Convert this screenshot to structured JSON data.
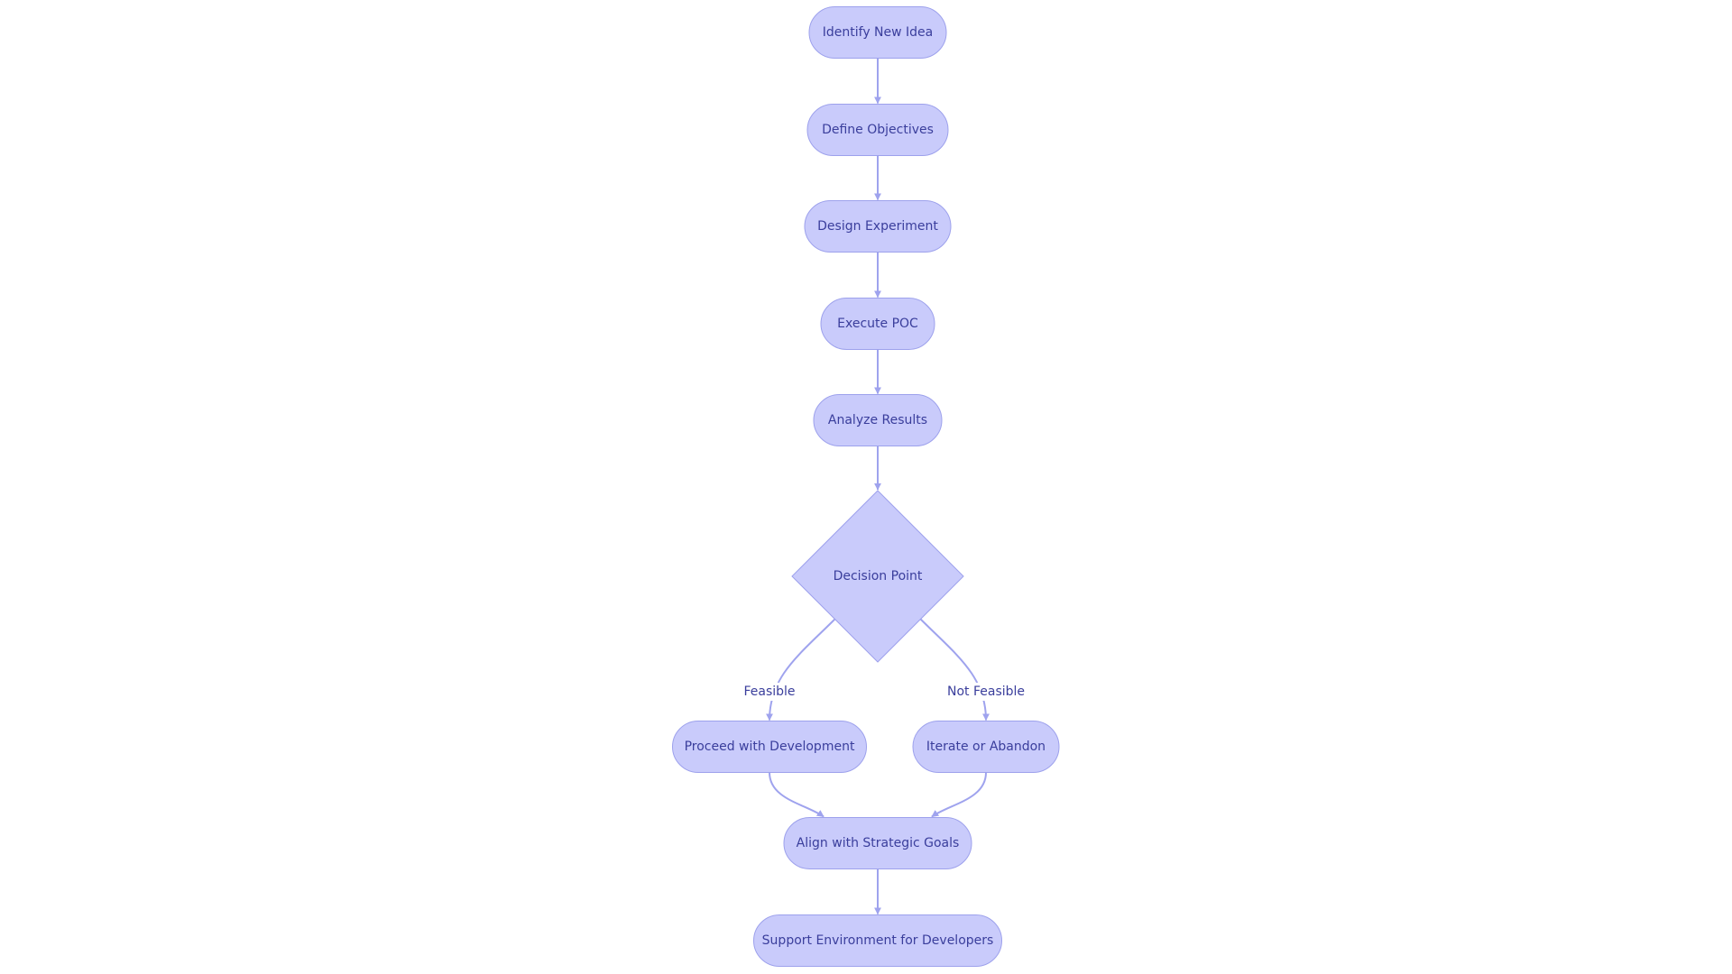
{
  "diagram": {
    "type": "flowchart",
    "direction": "top-to-bottom",
    "colors": {
      "node_fill": "#c9cbfb",
      "node_stroke": "#9da1ec",
      "edge": "#9fa3ee",
      "text": "#3a3e9c"
    },
    "nodes": [
      {
        "id": "identify",
        "label": "Identify New Idea",
        "shape": "stadium"
      },
      {
        "id": "define",
        "label": "Define Objectives",
        "shape": "stadium"
      },
      {
        "id": "design",
        "label": "Design Experiment",
        "shape": "stadium"
      },
      {
        "id": "execute",
        "label": "Execute POC",
        "shape": "stadium"
      },
      {
        "id": "analyze",
        "label": "Analyze Results",
        "shape": "stadium"
      },
      {
        "id": "decision",
        "label": "Decision Point",
        "shape": "diamond"
      },
      {
        "id": "proceed",
        "label": "Proceed with Development",
        "shape": "stadium"
      },
      {
        "id": "iterate",
        "label": "Iterate or Abandon",
        "shape": "stadium"
      },
      {
        "id": "align",
        "label": "Align with Strategic Goals",
        "shape": "stadium"
      },
      {
        "id": "support",
        "label": "Support Environment for Developers",
        "shape": "stadium"
      }
    ],
    "edges": [
      {
        "from": "identify",
        "to": "define",
        "label": ""
      },
      {
        "from": "define",
        "to": "design",
        "label": ""
      },
      {
        "from": "design",
        "to": "execute",
        "label": ""
      },
      {
        "from": "execute",
        "to": "analyze",
        "label": ""
      },
      {
        "from": "analyze",
        "to": "decision",
        "label": ""
      },
      {
        "from": "decision",
        "to": "proceed",
        "label": "Feasible"
      },
      {
        "from": "decision",
        "to": "iterate",
        "label": "Not Feasible"
      },
      {
        "from": "proceed",
        "to": "align",
        "label": ""
      },
      {
        "from": "iterate",
        "to": "align",
        "label": ""
      },
      {
        "from": "align",
        "to": "support",
        "label": ""
      }
    ]
  }
}
